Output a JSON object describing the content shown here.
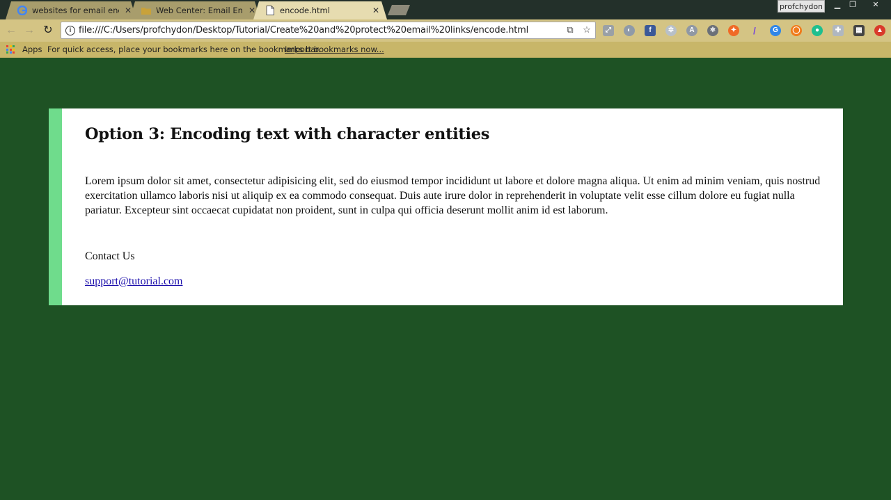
{
  "browser": {
    "tabs": [
      {
        "title": "websites for email encod",
        "icon": "google-icon",
        "active": false
      },
      {
        "title": "Web Center: Email Encoc",
        "icon": "folder-icon",
        "active": false
      },
      {
        "title": "encode.html",
        "icon": "file-icon",
        "active": true
      }
    ],
    "profile_name": "profchydon",
    "url": "file:///C:/Users/profchydon/Desktop/Tutorial/Create%20and%20protect%20email%20links/encode.html",
    "bookmarks": {
      "apps_label": "Apps",
      "message": "For quick access, place your bookmarks here on the bookmarks bar.",
      "import_link": "Import bookmarks now..."
    }
  },
  "page": {
    "heading": "Option 3: Encoding text with character entities",
    "paragraph": "Lorem ipsum dolor sit amet, consectetur adipisicing elit, sed do eiusmod tempor incididunt ut labore et dolore magna aliqua. Ut enim ad minim veniam, quis nostrud exercitation ullamco laboris nisi ut aliquip ex ea commodo consequat. Duis aute irure dolor in reprehenderit in voluptate velit esse cillum dolore eu fugiat nulla pariatur. Excepteur sint occaecat cupidatat non proident, sunt in culpa qui officia deserunt mollit anim id est laborum.",
    "contact_label": "Contact Us",
    "email": "support@tutorial.com"
  },
  "colors": {
    "page_background": "#1e5224",
    "card_background": "#ffffff",
    "card_accent": "#6fdc8c",
    "link": "#1a0dab"
  }
}
